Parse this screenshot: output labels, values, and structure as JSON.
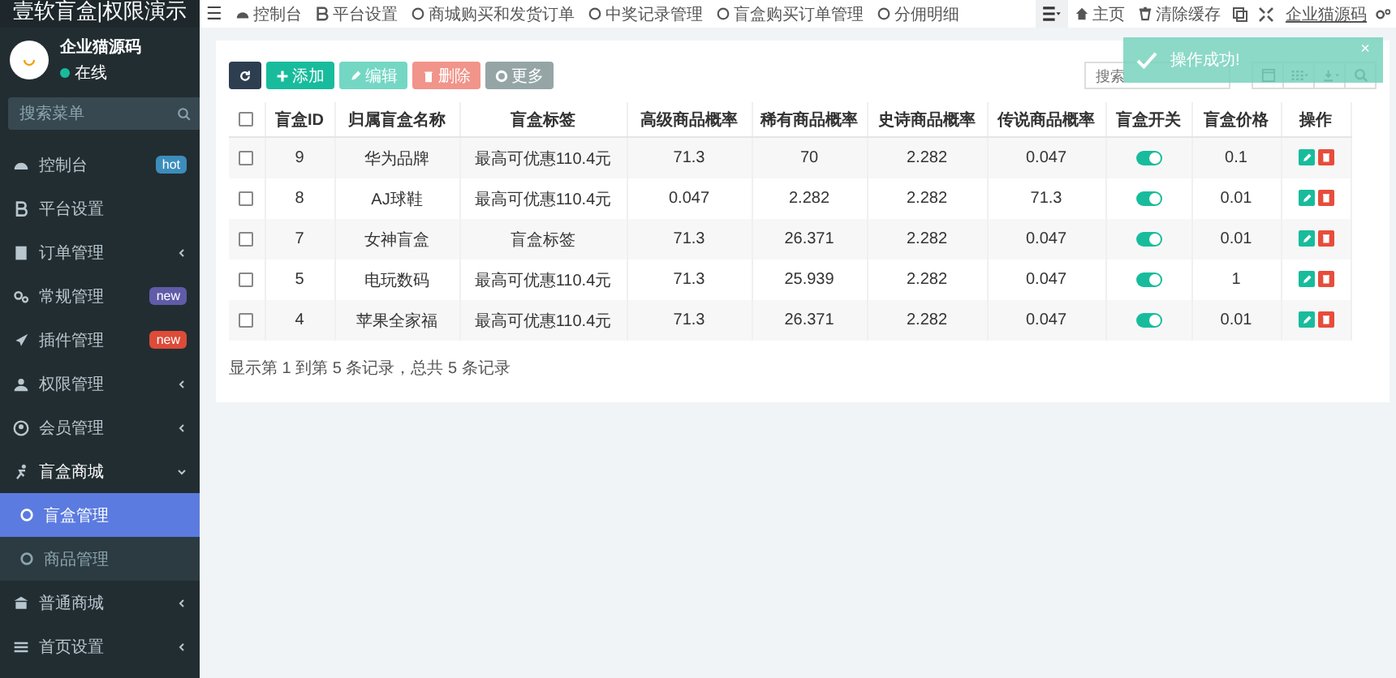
{
  "sidebar": {
    "title": "壹软盲盒|权限演示",
    "user": {
      "name": "企业猫源码",
      "status": "在线"
    },
    "search": {
      "placeholder": "搜索菜单"
    },
    "items": [
      {
        "label": "控制台",
        "badge": "hot",
        "color": "#3c8dbc",
        "caret": false,
        "expanded": false
      },
      {
        "label": "平台设置",
        "caret": false,
        "expanded": false
      },
      {
        "label": "订单管理",
        "caret": true,
        "expanded": false
      },
      {
        "label": "常规管理",
        "badge": "new",
        "color": "#605ca8",
        "caret": false,
        "expanded": false
      },
      {
        "label": "插件管理",
        "badge": "new",
        "color": "#dd4b39",
        "caret": false,
        "expanded": false
      },
      {
        "label": "权限管理",
        "caret": true,
        "expanded": false
      },
      {
        "label": "会员管理",
        "caret": true,
        "expanded": false
      },
      {
        "label": "盲盒商城",
        "caret": true,
        "expanded": true,
        "children": [
          {
            "label": "盲盒管理",
            "selected": true
          },
          {
            "label": "商品管理",
            "selected": false
          }
        ]
      },
      {
        "label": "普通商城",
        "caret": true,
        "expanded": false
      },
      {
        "label": "首页设置",
        "caret": true,
        "expanded": false
      }
    ]
  },
  "topbar": {
    "menu_icon": "☰",
    "tabs": [
      {
        "label": "控制台"
      },
      {
        "label": "平台设置"
      },
      {
        "label": "商城购买和发货订单"
      },
      {
        "label": "中奖记录管理"
      },
      {
        "label": "盲盒购买订单管理"
      },
      {
        "label": "分佣明细"
      }
    ],
    "right": [
      {
        "label": "主页"
      },
      {
        "label": "清除缓存"
      }
    ],
    "user": "企业猫源码"
  },
  "toolbar": {
    "buttons": [
      {
        "kind": "refresh",
        "disabled": false
      },
      {
        "kind": "add",
        "label": "添加",
        "disabled": false
      },
      {
        "kind": "edit",
        "label": "编辑",
        "disabled": true
      },
      {
        "kind": "delete",
        "label": "删除",
        "disabled": true
      },
      {
        "kind": "more",
        "label": "更多",
        "disabled": false
      }
    ],
    "search": {
      "placeholder": "搜索"
    }
  },
  "table": {
    "select_all_checked": false,
    "columns": [
      "盲盒ID",
      "归属盲盒名称",
      "盲盒标签",
      "高级商品概率",
      "稀有商品概率",
      "史诗商品概率",
      "传说商品概率",
      "盲盒开关",
      "盲盒价格",
      "操作"
    ],
    "rows": [
      {
        "checked": false,
        "cells": [
          "9",
          "华为品牌",
          "最高可优惠110.4元",
          "71.3",
          "70",
          "2.282",
          "0.047"
        ],
        "on": true,
        "price": "0.1"
      },
      {
        "checked": false,
        "cells": [
          "8",
          "AJ球鞋",
          "最高可优惠110.4元",
          "0.047",
          "2.282",
          "2.282",
          "71.3"
        ],
        "on": true,
        "price": "0.01"
      },
      {
        "checked": false,
        "cells": [
          "7",
          "女神盲盒",
          "盲盒标签",
          "71.3",
          "26.371",
          "2.282",
          "0.047"
        ],
        "on": true,
        "price": "0.01"
      },
      {
        "checked": false,
        "cells": [
          "5",
          "电玩数码",
          "最高可优惠110.4元",
          "71.3",
          "25.939",
          "2.282",
          "0.047"
        ],
        "on": true,
        "price": "1"
      },
      {
        "checked": false,
        "cells": [
          "4",
          "苹果全家福",
          "最高可优惠110.4元",
          "71.3",
          "26.371",
          "2.282",
          "0.047"
        ],
        "on": true,
        "price": "0.01"
      }
    ],
    "footer": "显示第 1 到第 5 条记录，总共 5 条记录"
  },
  "toast": {
    "message": "操作成功!",
    "close": "×"
  }
}
